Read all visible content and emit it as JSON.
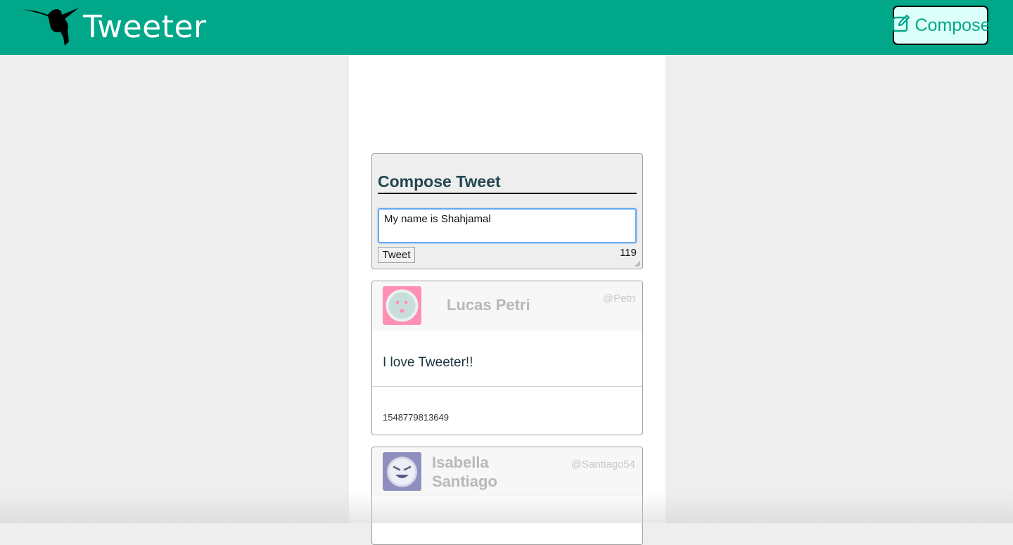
{
  "colors": {
    "nav_bg": "#00a789",
    "compose_button_bg": "#dcfffa",
    "heading_color": "#244751",
    "avatar_pink": "#ff8fb3",
    "avatar_purple": "#8f8fbf"
  },
  "nav": {
    "logo_icon": "hummingbird-icon",
    "title": "Tweeter",
    "compose_icon": "edit-icon",
    "compose_label": "Compose"
  },
  "compose": {
    "heading": "Compose Tweet",
    "input_value": "My name is Shahjamal",
    "button_label": "Tweet",
    "counter": "119"
  },
  "tweets": [
    {
      "name": "Lucas Petri",
      "handle": "@Petri",
      "avatar_icon": "smiley-face-icon",
      "text": "I love Tweeter!!",
      "timestamp": "1548779813649"
    },
    {
      "name": "Isabella Santiago",
      "handle": "@Santiago54",
      "avatar_icon": "devil-face-icon",
      "text": "",
      "timestamp": ""
    }
  ]
}
